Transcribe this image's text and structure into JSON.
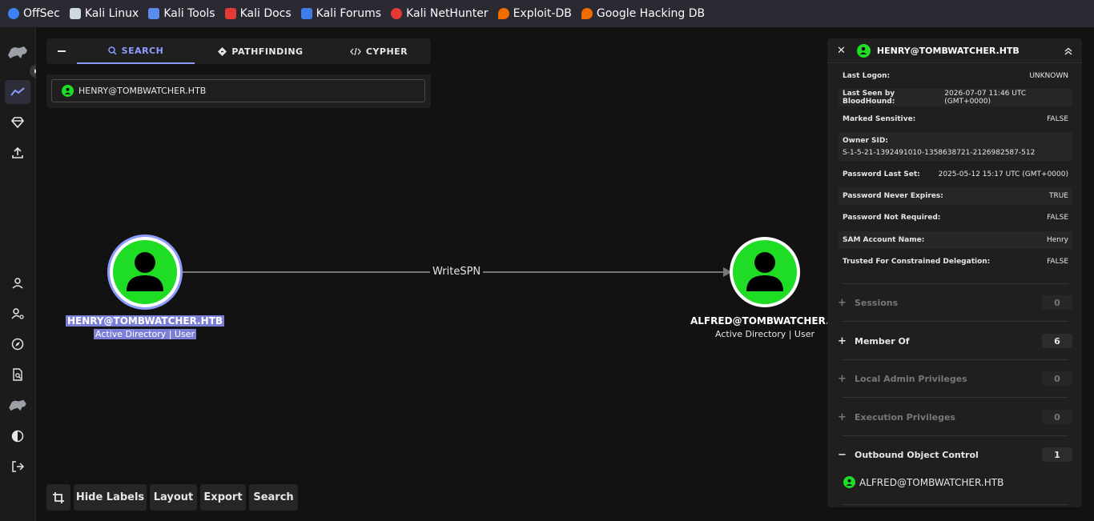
{
  "bookmarks": [
    {
      "label": "OffSec",
      "icon": "offsec-icon",
      "color": "#3b82f6"
    },
    {
      "label": "Kali Linux",
      "icon": "kali-dragon-icon",
      "color": "#cfd8dc"
    },
    {
      "label": "Kali Tools",
      "icon": "kali-tools-icon",
      "color": "#5b8def"
    },
    {
      "label": "Kali Docs",
      "icon": "kali-docs-icon",
      "color": "#e53935"
    },
    {
      "label": "Kali Forums",
      "icon": "kali-forums-icon",
      "color": "#3f7ee8"
    },
    {
      "label": "Kali NetHunter",
      "icon": "nethunter-icon",
      "color": "#e53935"
    },
    {
      "label": "Exploit-DB",
      "icon": "exploitdb-icon",
      "color": "#ef6c00"
    },
    {
      "label": "Google Hacking DB",
      "icon": "ghdb-icon",
      "color": "#ef6c00"
    }
  ],
  "rail": {
    "items": [
      "bloodhound-logo-icon",
      "explore-icon",
      "gem-icon",
      "upload-icon",
      "user-icon",
      "user-settings-icon",
      "compass-icon",
      "search-doc-icon",
      "bloodhound-icon",
      "contrast-icon",
      "logout-icon"
    ]
  },
  "search_panel": {
    "tabs": [
      {
        "label": "SEARCH",
        "icon": "search-icon"
      },
      {
        "label": "PATHFINDING",
        "icon": "diamond-icon"
      },
      {
        "label": "CYPHER",
        "icon": "code-icon"
      }
    ],
    "query": "HENRY@TOMBWATCHER.HTB"
  },
  "graph": {
    "source": {
      "label": "HENRY@TOMBWATCHER.HTB",
      "sub": "Active Directory | User"
    },
    "target": {
      "label": "ALFRED@TOMBWATCHER.H",
      "sub": "Active Directory | User"
    },
    "edge_label": "WriteSPN"
  },
  "toolbar": {
    "buttons": [
      "Hide Labels",
      "Layout",
      "Export",
      "Search"
    ]
  },
  "details": {
    "title": "HENRY@TOMBWATCHER.HTB",
    "properties": [
      {
        "key": "Last Logon:",
        "value": "UNKNOWN"
      },
      {
        "key": "Last Seen by BloodHound:",
        "value": "2026-07-07 11:46 UTC (GMT+0000)"
      },
      {
        "key": "Marked Sensitive:",
        "value": "FALSE"
      },
      {
        "key": "Owner SID:",
        "value": "S-1-5-21-1392491010-1358638721-2126982587-512"
      },
      {
        "key": "Password Last Set:",
        "value": "2025-05-12 15:17 UTC (GMT+0000)"
      },
      {
        "key": "Password Never Expires:",
        "value": "TRUE"
      },
      {
        "key": "Password Not Required:",
        "value": "FALSE"
      },
      {
        "key": "SAM Account Name:",
        "value": "Henry"
      },
      {
        "key": "Trusted For Constrained Delegation:",
        "value": "FALSE"
      }
    ],
    "sections": [
      {
        "sign": "+",
        "name": "Sessions",
        "count": "0"
      },
      {
        "sign": "+",
        "name": "Member Of",
        "count": "6"
      },
      {
        "sign": "+",
        "name": "Local Admin Privileges",
        "count": "0"
      },
      {
        "sign": "+",
        "name": "Execution Privileges",
        "count": "0"
      },
      {
        "sign": "−",
        "name": "Outbound Object Control",
        "count": "1"
      }
    ],
    "outbound_item": "ALFRED@TOMBWATCHER.HTB"
  },
  "colors": {
    "accent": "#8f9cff",
    "user_node": "#1fdd24",
    "highlight": "#7b7fd8"
  }
}
